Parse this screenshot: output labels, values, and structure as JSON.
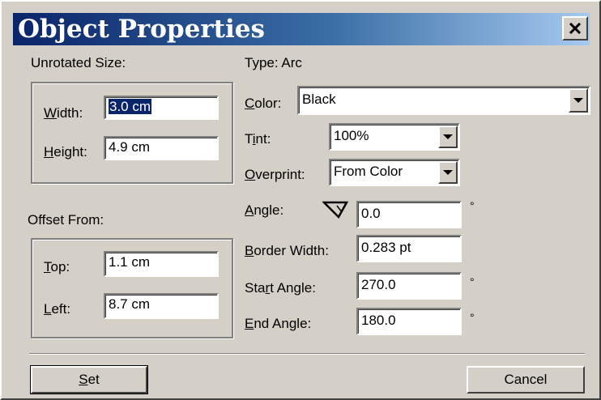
{
  "dialog": {
    "title": "Object Properties",
    "close_glyph": "✕"
  },
  "left": {
    "unrotated_size_label": "Unrotated Size:",
    "width_label": "idth:",
    "width_mnemonic": "W",
    "width_value": "3.0 cm",
    "height_label": "eight:",
    "height_mnemonic": "H",
    "height_value": "4.9 cm",
    "offset_from_label": "Offset From:",
    "top_label": "op:",
    "top_mnemonic": "T",
    "top_value": "1.1 cm",
    "left_label": "eft:",
    "left_mnemonic": "L",
    "left_value": "8.7 cm"
  },
  "right": {
    "type_label": "Type:  Arc",
    "color_label": "olor:",
    "color_mnemonic": "C",
    "color_value": "Black",
    "tint_label_pre": "T",
    "tint_mnemonic": "i",
    "tint_label_post": "nt:",
    "tint_value": "100%",
    "overprint_label": "verprint:",
    "overprint_mnemonic": "O",
    "overprint_value": "From Color",
    "angle_label": "ngle:",
    "angle_mnemonic": "A",
    "angle_value": "0.0",
    "border_width_label": "order Width:",
    "border_width_mnemonic": "B",
    "border_width_value": "0.283 pt",
    "start_angle_label_pre": "Sta",
    "start_angle_mnemonic": "r",
    "start_angle_label_post": "t Angle:",
    "start_angle_value": "270.0",
    "end_angle_label": "nd Angle:",
    "end_angle_mnemonic": "E",
    "end_angle_value": "180.0",
    "degree_symbol": "°"
  },
  "footer": {
    "set_mnemonic": "S",
    "set_label": "et",
    "cancel_label": "Cancel"
  },
  "icons": {
    "angle_icon": "angle-icon",
    "close_icon": "close-icon",
    "dropdown_icon": "chevron-down-icon"
  }
}
